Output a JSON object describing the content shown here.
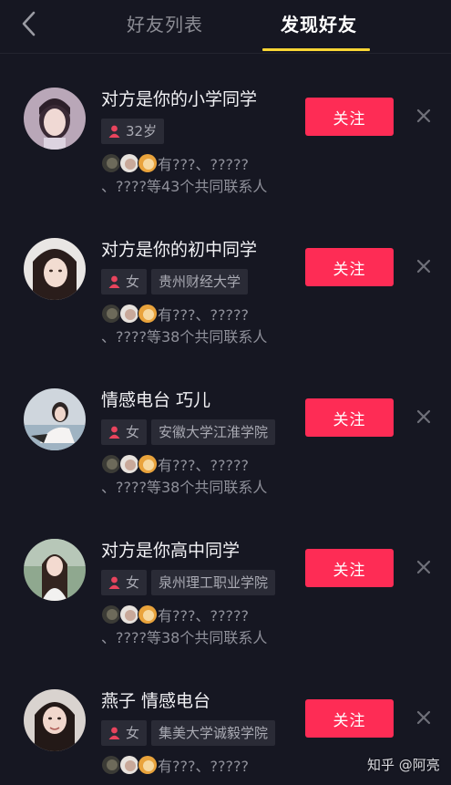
{
  "header": {
    "tabs": [
      {
        "label": "好友列表",
        "active": false
      },
      {
        "label": "发现好友",
        "active": true
      }
    ]
  },
  "colors": {
    "background": "#161722",
    "follow_button": "#fe2c55",
    "tab_indicator": "#f8d534",
    "tag_background": "#2a2b36"
  },
  "suggestions": [
    {
      "name": "对方是你的小学同学",
      "tags": [
        {
          "icon": "person-icon",
          "text": "32岁"
        }
      ],
      "mutual_line1": "有???、?????",
      "mutual_line2": "、????等43个共同联系人",
      "follow_label": "关注"
    },
    {
      "name": "对方是你的初中同学",
      "tags": [
        {
          "icon": "person-icon",
          "text": "女"
        },
        {
          "text": "贵州财经大学"
        }
      ],
      "mutual_line1": "有???、?????",
      "mutual_line2": "、????等38个共同联系人",
      "follow_label": "关注"
    },
    {
      "name": "情感电台  巧儿",
      "tags": [
        {
          "icon": "person-icon",
          "text": "女"
        },
        {
          "text": "安徽大学江淮学院"
        }
      ],
      "mutual_line1": "有???、?????",
      "mutual_line2": "、????等38个共同联系人",
      "follow_label": "关注"
    },
    {
      "name": "对方是你高中同学",
      "tags": [
        {
          "icon": "person-icon",
          "text": "女"
        },
        {
          "text": "泉州理工职业学院"
        }
      ],
      "mutual_line1": "有???、?????",
      "mutual_line2": "、????等38个共同联系人",
      "follow_label": "关注"
    },
    {
      "name": "燕子  情感电台",
      "tags": [
        {
          "icon": "person-icon",
          "text": "女"
        },
        {
          "text": "集美大学诚毅学院"
        }
      ],
      "mutual_line1": "有???、?????",
      "mutual_line2": "",
      "follow_label": "关注"
    }
  ],
  "watermark": "知乎 @阿亮"
}
